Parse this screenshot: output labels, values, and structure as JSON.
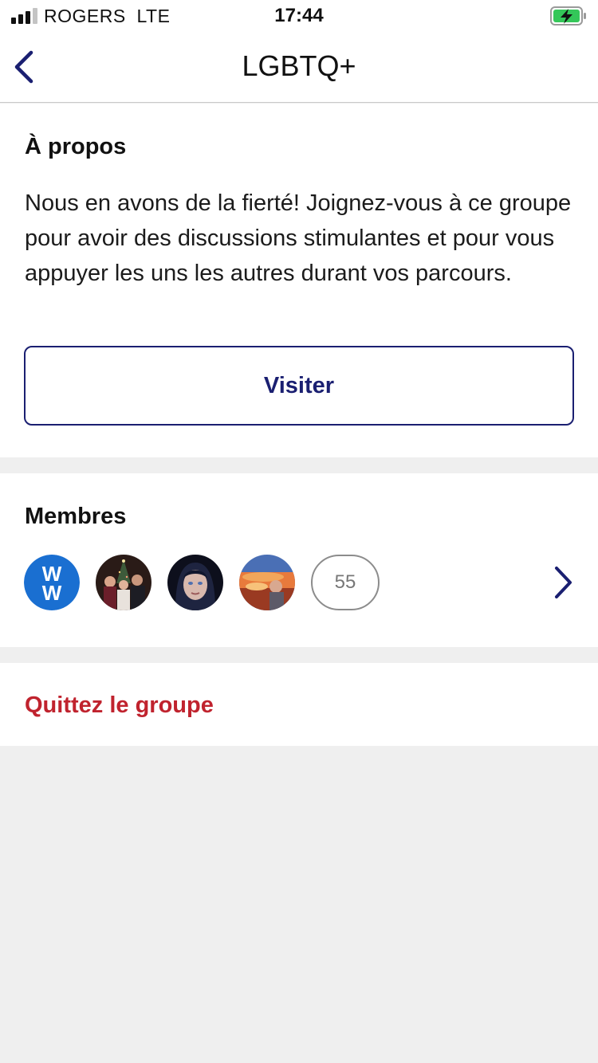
{
  "status_bar": {
    "carrier": "ROGERS",
    "network": "LTE",
    "time": "17:44",
    "signal_bars": 3,
    "signal_bars_total": 4,
    "battery_icon": "battery-charging-icon",
    "battery_color": "#34c759"
  },
  "nav": {
    "title": "LGBTQ+",
    "back_icon": "chevron-left-icon"
  },
  "about": {
    "heading": "À propos",
    "body": "Nous en avons de la fierté! Joignez-vous à ce groupe pour avoir des discussions stimulantes et pour vous appuyer les uns les autres durant vos parcours.",
    "visit_label": "Visiter"
  },
  "members": {
    "heading": "Membres",
    "avatars": [
      {
        "name": "ww-logo-avatar"
      },
      {
        "name": "member-avatar-group-photo"
      },
      {
        "name": "member-avatar-portrait"
      },
      {
        "name": "member-avatar-sunset"
      }
    ],
    "count": "55",
    "more_icon": "chevron-right-icon"
  },
  "leave": {
    "label": "Quittez le groupe"
  },
  "colors": {
    "accent_navy": "#1a1f71",
    "danger_red": "#c0232e",
    "ww_blue": "#1a6fd1",
    "page_background": "#efefef"
  }
}
